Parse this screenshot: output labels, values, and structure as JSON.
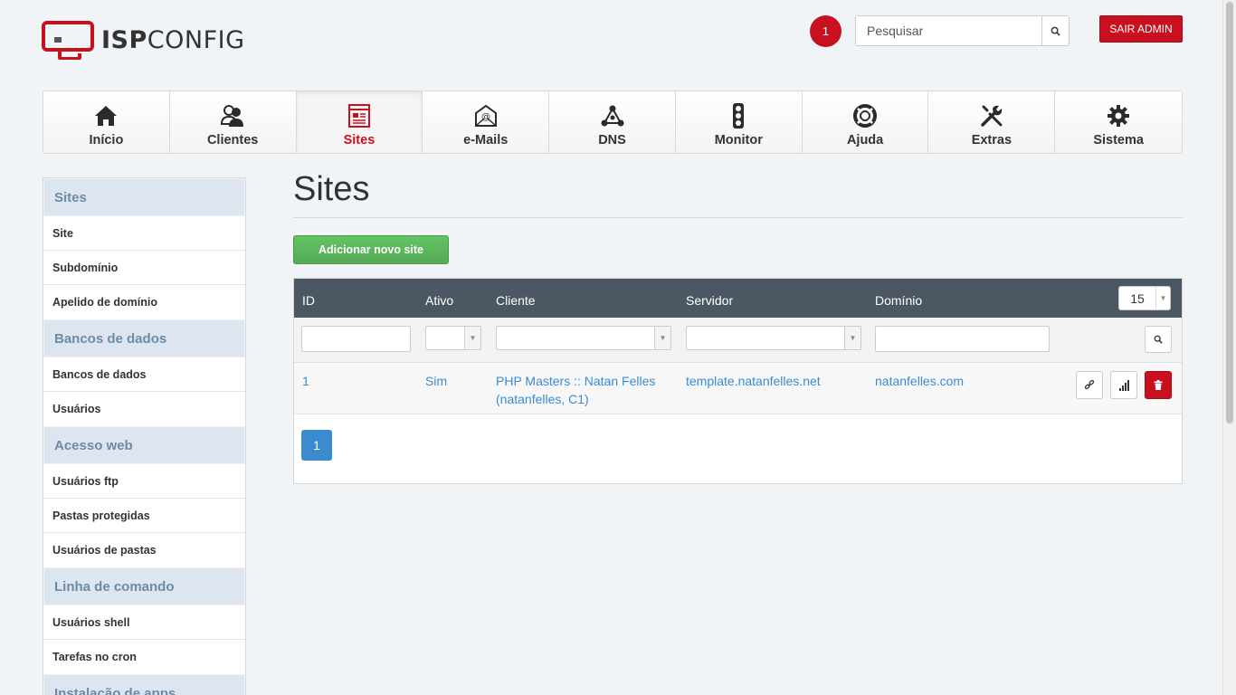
{
  "brand": {
    "logo_bold": "ISP",
    "logo_light": "CONFIG",
    "accent": "#c8101e"
  },
  "header": {
    "notification_count": "1",
    "search_placeholder": "Pesquisar",
    "logout_label": "SAIR ADMIN"
  },
  "nav": {
    "items": [
      {
        "label": "Início",
        "icon": "home-icon"
      },
      {
        "label": "Clientes",
        "icon": "users-icon"
      },
      {
        "label": "Sites",
        "icon": "website-icon",
        "active": true
      },
      {
        "label": "e-Mails",
        "icon": "envelope-at-icon"
      },
      {
        "label": "DNS",
        "icon": "dns-nodes-icon"
      },
      {
        "label": "Monitor",
        "icon": "traffic-light-icon"
      },
      {
        "label": "Ajuda",
        "icon": "lifebuoy-icon"
      },
      {
        "label": "Extras",
        "icon": "tools-icon"
      },
      {
        "label": "Sistema",
        "icon": "gear-icon"
      }
    ]
  },
  "sidebar": {
    "sections": [
      {
        "title": "Sites",
        "items": [
          "Site",
          "Subdomínio",
          "Apelido de domínio"
        ]
      },
      {
        "title": "Bancos de dados",
        "items": [
          "Bancos de dados",
          "Usuários"
        ]
      },
      {
        "title": "Acesso web",
        "items": [
          "Usuários ftp",
          "Pastas protegidas",
          "Usuários de pastas"
        ]
      },
      {
        "title": "Linha de comando",
        "items": [
          "Usuários shell",
          "Tarefas no cron"
        ]
      },
      {
        "title": "Instalação de apps",
        "items": []
      }
    ]
  },
  "main": {
    "title": "Sites",
    "add_button": "Adicionar novo site",
    "table": {
      "columns": [
        "ID",
        "Ativo",
        "Cliente",
        "Servidor",
        "Domínio"
      ],
      "page_size": "15",
      "rows": [
        {
          "id": "1",
          "active": "Sim",
          "client_line1": "PHP Masters :: Natan Felles",
          "client_line2": "(natanfelles, C1)",
          "server": "template.natanfelles.net",
          "domain": "natanfelles.com"
        }
      ],
      "current_page": "1"
    }
  }
}
